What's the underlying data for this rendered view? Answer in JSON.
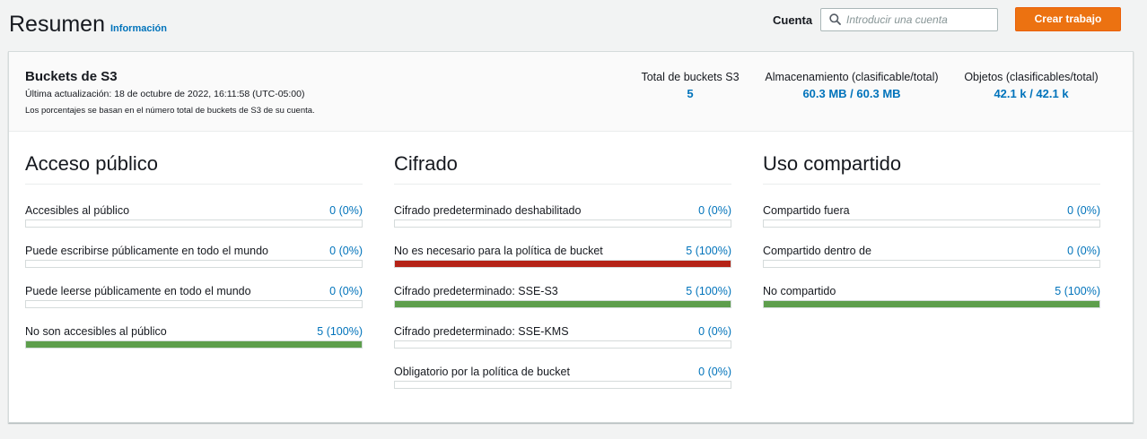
{
  "header": {
    "title": "Resumen",
    "info_link": "Información",
    "account_label": "Cuenta",
    "search_placeholder": "Introducir una cuenta",
    "search_value": "",
    "create_button": "Crear trabajo"
  },
  "summary": {
    "title": "Buckets de S3",
    "last_updated": "Última actualización: 18 de octubre de 2022, 16:11:58 (UTC-05:00)",
    "note": "Los porcentajes se basan en el número total de buckets de S3 de su cuenta.",
    "metrics": [
      {
        "label": "Total de buckets S3",
        "value": "5"
      },
      {
        "label": "Almacenamiento (clasificable/total)",
        "value": "60.3 MB / 60.3 MB"
      },
      {
        "label": "Objetos (clasificables/total)",
        "value": "42.1 k / 42.1 k"
      }
    ]
  },
  "sections": [
    {
      "title": "Acceso público",
      "rows": [
        {
          "label": "Accesibles al público",
          "value": "0 (0%)",
          "percent": 0,
          "status": "ok"
        },
        {
          "label": "Puede escribirse públicamente en todo el mundo",
          "value": "0 (0%)",
          "percent": 0,
          "status": "ok"
        },
        {
          "label": "Puede leerse públicamente en todo el mundo",
          "value": "0 (0%)",
          "percent": 0,
          "status": "ok"
        },
        {
          "label": "No son accesibles al público",
          "value": "5 (100%)",
          "percent": 100,
          "status": "ok"
        }
      ]
    },
    {
      "title": "Cifrado",
      "rows": [
        {
          "label": "Cifrado predeterminado deshabilitado",
          "value": "0 (0%)",
          "percent": 0,
          "status": "ok"
        },
        {
          "label": "No es necesario para la política de bucket",
          "value": "5 (100%)",
          "percent": 100,
          "status": "bad"
        },
        {
          "label": "Cifrado predeterminado: SSE-S3",
          "value": "5 (100%)",
          "percent": 100,
          "status": "ok"
        },
        {
          "label": "Cifrado predeterminado: SSE-KMS",
          "value": "0 (0%)",
          "percent": 0,
          "status": "ok"
        },
        {
          "label": "Obligatorio por la política de bucket",
          "value": "0 (0%)",
          "percent": 0,
          "status": "ok"
        }
      ]
    },
    {
      "title": "Uso compartido",
      "rows": [
        {
          "label": "Compartido fuera",
          "value": "0 (0%)",
          "percent": 0,
          "status": "ok"
        },
        {
          "label": "Compartido dentro de",
          "value": "0 (0%)",
          "percent": 0,
          "status": "ok"
        },
        {
          "label": "No compartido",
          "value": "5 (100%)",
          "percent": 100,
          "status": "ok"
        }
      ]
    }
  ],
  "colors": {
    "accent": "#ec7211",
    "link": "#0073bb",
    "ok": "#5d9e4c",
    "bad": "#b52317"
  },
  "icons": {
    "search": "search-icon"
  }
}
